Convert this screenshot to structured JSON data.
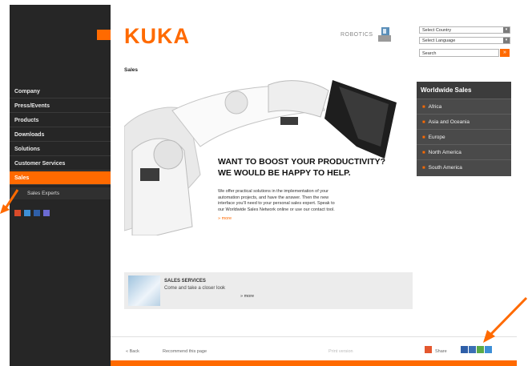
{
  "brand": {
    "logo": "KUKA",
    "tagline": "ROBOTICS"
  },
  "header": {
    "country_select": "Select Country",
    "language_select": "Select Language",
    "search_value": "Search",
    "search_button": "»"
  },
  "sidebar": {
    "items": [
      {
        "label": "Company"
      },
      {
        "label": "Press/Events"
      },
      {
        "label": "Products"
      },
      {
        "label": "Downloads"
      },
      {
        "label": "Solutions"
      },
      {
        "label": "Customer Services"
      },
      {
        "label": "Sales"
      }
    ],
    "subitems": [
      {
        "label": "Sales Experts"
      }
    ]
  },
  "page": {
    "title": "Sales",
    "headline_1": "WANT TO BOOST YOUR PRODUCTIVITY?",
    "headline_2": "WE WOULD BE HAPPY TO HELP.",
    "body_1": "We offer practical solutions in the implementation of your",
    "body_2": "automation projects, and have the answer. Then the new",
    "body_3": "interface you'll need to your personal sales expert. Speak to",
    "body_4": "our Worldwide Sales Network online or use our contact tool.",
    "more": "» more"
  },
  "worldwide_sales": {
    "title": "Worldwide Sales",
    "regions": [
      "Africa",
      "Asia and Oceania",
      "Europe",
      "North America",
      "South America"
    ]
  },
  "teaser": {
    "title": "SALES SERVICES",
    "desc": "Come and take a closer look",
    "more": "» more"
  },
  "footer": {
    "back": "« Back",
    "recommend": "Recommend this page",
    "print": "Print version",
    "share": "Share"
  },
  "colors": {
    "accent": "#ff6a00",
    "sidebar": "#262626"
  }
}
